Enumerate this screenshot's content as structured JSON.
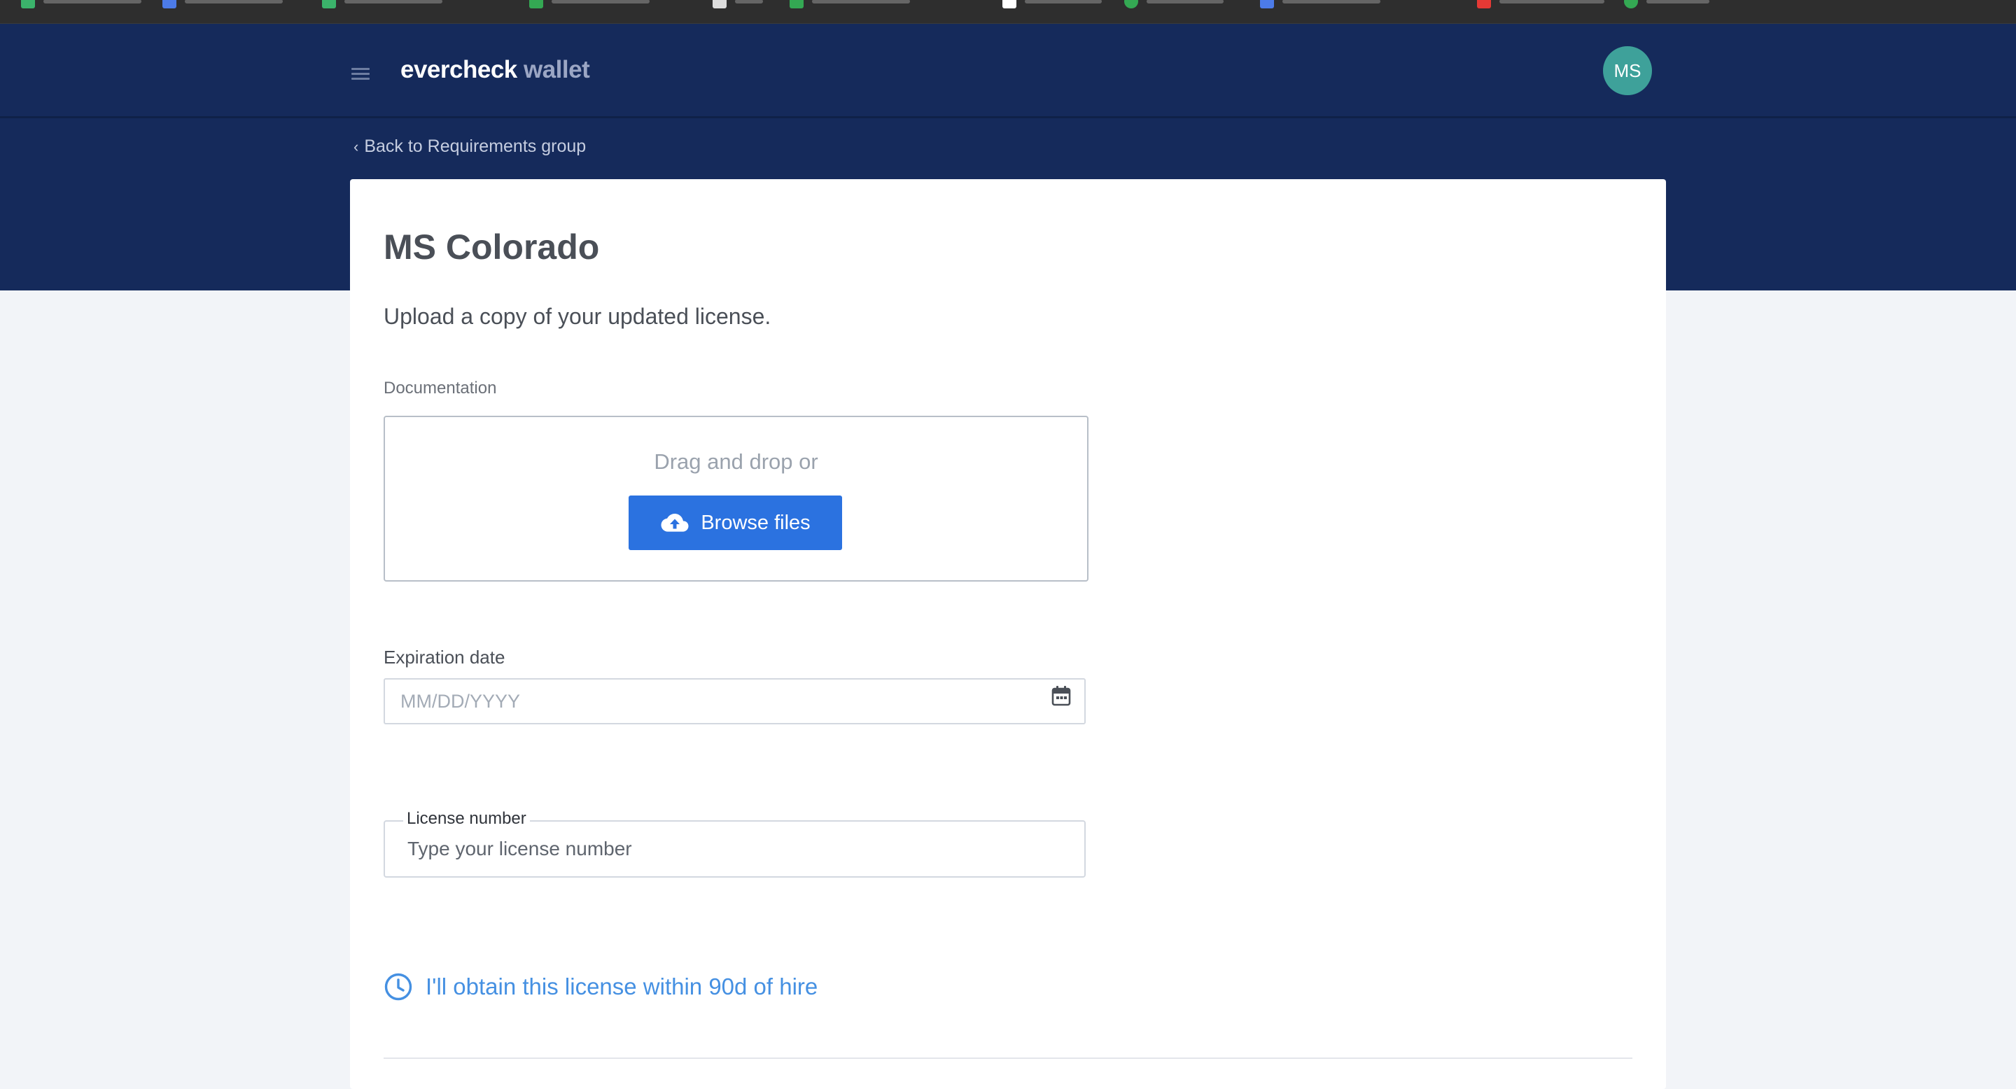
{
  "app": {
    "brand_main": "evercheck",
    "brand_sub": " wallet",
    "avatar_initials": "MS"
  },
  "navigation": {
    "back_link": "Back to Requirements group"
  },
  "requirement": {
    "title": "MS Colorado",
    "instruction": "Upload a copy of your updated license."
  },
  "documentation": {
    "label": "Documentation",
    "dropzone_text": "Drag and drop or",
    "browse_label": "Browse files"
  },
  "expiration": {
    "label": "Expiration date",
    "placeholder": "MM/DD/YYYY",
    "value": ""
  },
  "license": {
    "label": "License number",
    "placeholder": "Type your license number",
    "value": ""
  },
  "obtain_later": {
    "label": "I'll obtain this license within 90d of hire"
  },
  "colors": {
    "header_bg": "#152a5b",
    "primary_button": "#2b72e0",
    "link_blue": "#4590e2",
    "avatar_bg": "#3ea19a",
    "page_bg": "#f2f4f8"
  },
  "icons": {
    "menu": "hamburger-icon",
    "back": "chevron-left-icon",
    "upload": "cloud-upload-icon",
    "calendar": "calendar-icon",
    "clock": "clock-icon"
  }
}
